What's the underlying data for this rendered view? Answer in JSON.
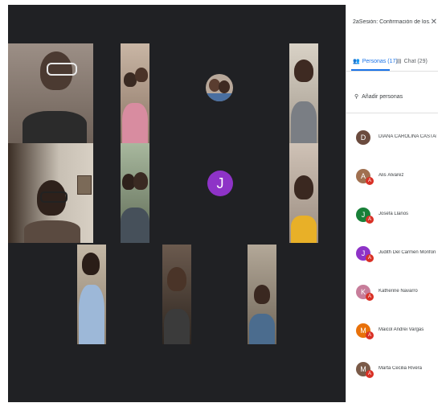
{
  "meeting": {
    "title": "2aSesión: Confirmación de los...",
    "close_icon": "close-icon"
  },
  "tabs": {
    "people_label": "Personas (17)",
    "chat_label": "Chat (29)"
  },
  "add_people_label": "Añadir personas",
  "participants": [
    {
      "initial": "D",
      "name": "DIANA CAROLINA CASTAÑO B...",
      "color": "#6b4b3e",
      "badge": ""
    },
    {
      "initial": "A",
      "name": "Alis Álvarez",
      "color": "#a07050",
      "badge": "A"
    },
    {
      "initial": "J",
      "name": "Josefa Llanos",
      "color": "#188038",
      "badge": "A"
    },
    {
      "initial": "J",
      "name": "Judith Del Carmen Monfon",
      "color": "#8e33c7",
      "badge": "A"
    },
    {
      "initial": "K",
      "name": "Katherine Navarro",
      "color": "#c77d9a",
      "badge": "A"
    },
    {
      "initial": "M",
      "name": "Maicol Andrei Vargas",
      "color": "#e8710a",
      "badge": "A"
    },
    {
      "initial": "M",
      "name": "Marta Cecilia Rivera",
      "color": "#7a5a48",
      "badge": "A"
    }
  ],
  "stage": {
    "avatar_initial": "J",
    "avatar_color": "#8e33c7"
  }
}
